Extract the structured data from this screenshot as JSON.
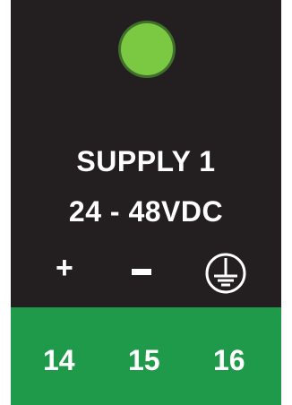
{
  "indicator": {
    "color": "#7bc943",
    "icon": "status-led-icon"
  },
  "label": {
    "line1": "SUPPLY 1",
    "line2": "24 - 48VDC"
  },
  "polarity": {
    "plus": "+",
    "minus_icon": "minus-icon",
    "ground_icon": "ground-icon"
  },
  "terminals": [
    "14",
    "15",
    "16"
  ],
  "colors": {
    "panel": "#231f20",
    "terminal_block": "#1f9a4a",
    "text": "#ffffff"
  }
}
